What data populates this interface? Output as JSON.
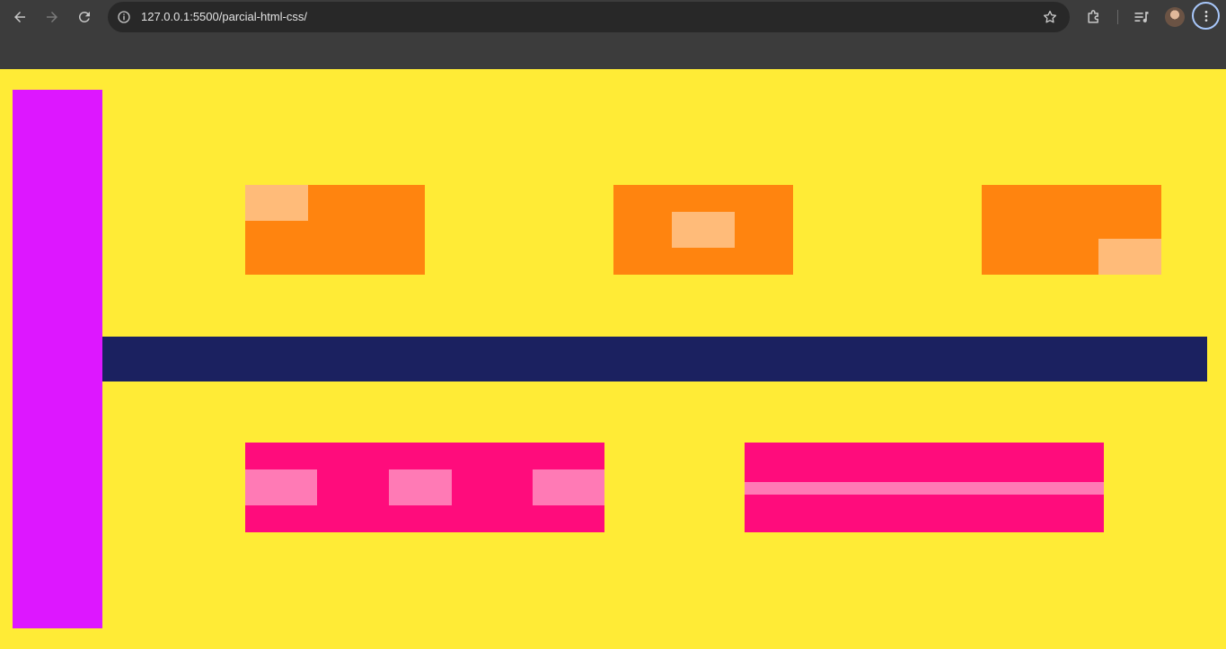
{
  "browser": {
    "url": "127.0.0.1:5500/parcial-html-css/",
    "icons": {
      "back": "back-arrow-icon",
      "forward": "forward-arrow-icon",
      "reload": "reload-icon",
      "site_info": "site-info-icon",
      "bookmark": "star-icon",
      "extensions": "puzzle-icon",
      "media": "media-queue-icon",
      "menu": "kebab-menu-icon"
    },
    "colors": {
      "toolbar": "#3c3c3c",
      "omnibox": "#282828",
      "icon": "#c7c7c7",
      "focus_ring": "#a8c7fa"
    }
  },
  "page": {
    "colors": {
      "background": "#ffeb36",
      "sidebar": "#dd17ff",
      "divider_bar": "#1b2160",
      "orange_box": "#ff840f",
      "orange_inner": "#ffbb79",
      "pink_box": "#ff0c7c",
      "pink_inner": "#ff7ab5"
    }
  }
}
